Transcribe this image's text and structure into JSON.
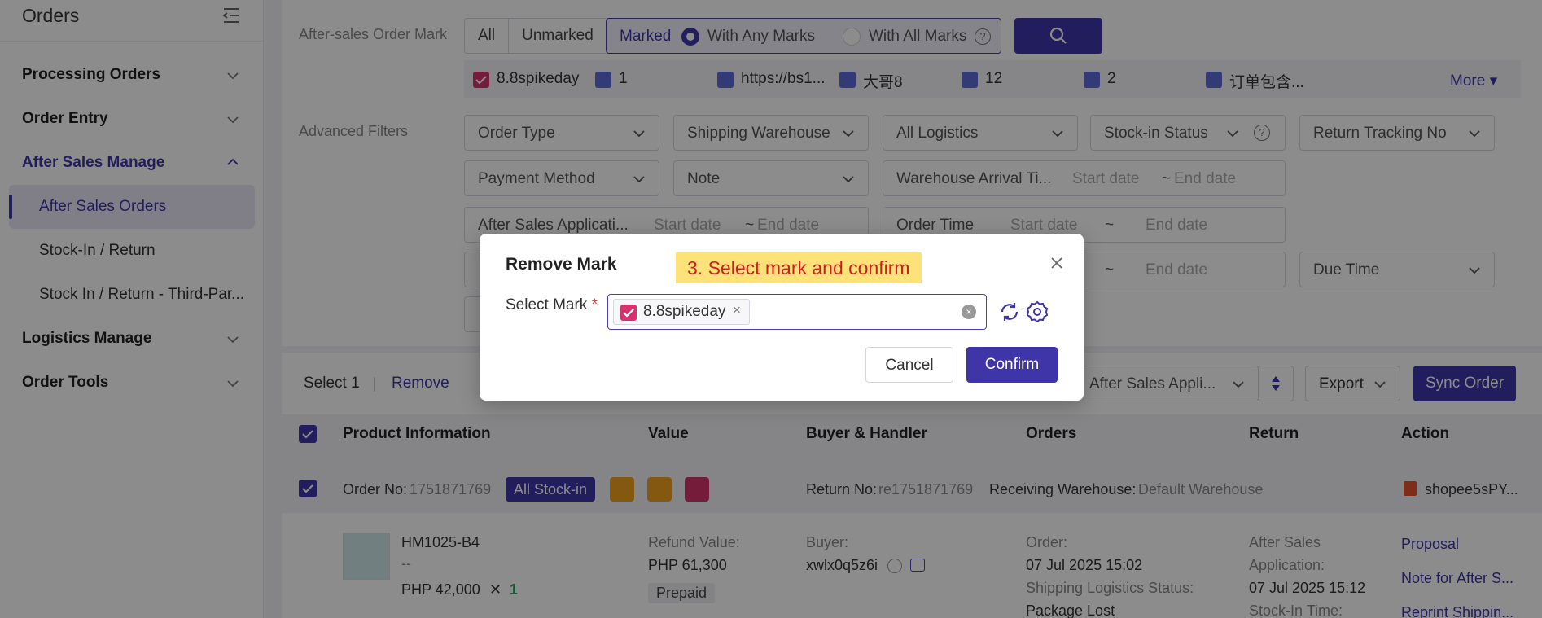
{
  "sidebar": {
    "title": "Orders",
    "groups": [
      {
        "label": "Processing Orders"
      },
      {
        "label": "Order Entry"
      },
      {
        "label": "After Sales Manage"
      },
      {
        "label": "Logistics Manage"
      },
      {
        "label": "Order Tools"
      }
    ],
    "items": [
      {
        "label": "After Sales Orders"
      },
      {
        "label": "Stock-In / Return"
      },
      {
        "label": "Stock In / Return - Third-Par..."
      }
    ]
  },
  "filters": {
    "mark_label": "After-sales Order Mark",
    "seg_all": "All",
    "seg_unmarked": "Unmarked",
    "seg_marked": "Marked",
    "radio_any": "With Any Marks",
    "radio_all": "With All Marks",
    "help": "?",
    "marks": [
      {
        "label": "8.8spikeday",
        "color": "#d6336c"
      },
      {
        "label": "1",
        "color": "#5b6cd6"
      },
      {
        "label": "https://bs1...",
        "color": "#5b6cd6"
      },
      {
        "label": "大哥8",
        "color": "#5b6cd6"
      },
      {
        "label": "12",
        "color": "#5b6cd6"
      },
      {
        "label": "2",
        "color": "#5b6cd6"
      },
      {
        "label": "订单包含...",
        "color": "#5b6cd6"
      }
    ],
    "more": "More",
    "advanced_label": "Advanced Filters",
    "order_type": "Order Type",
    "shipping_warehouse": "Shipping Warehouse",
    "all_logistics": "All Logistics",
    "stockin_status": "Stock-in Status",
    "return_tracking": "Return Tracking No",
    "payment_method": "Payment Method",
    "note": "Note",
    "warehouse_arrival": "Warehouse Arrival Ti...",
    "start_date": "Start date",
    "end_date": "End date",
    "tilde": "~",
    "after_sales_app": "After Sales Applicati...",
    "order_time": "Order Time",
    "due_time": "Due Time"
  },
  "toolbar": {
    "select_count": "Select 1",
    "remove": "Remove",
    "sort_field": "After Sales Appli...",
    "export": "Export",
    "sync": "Sync Order"
  },
  "table": {
    "headers": [
      "Product Information",
      "Value",
      "Buyer & Handler",
      "Orders",
      "Return",
      "Action"
    ],
    "order_no_label": "Order No:",
    "order_no": "1751871769",
    "stock_badge": "All Stock-in",
    "return_no_label": "Return No:",
    "return_no": "re1751871769",
    "receiving_label": "Receiving Warehouse:",
    "receiving_value": "Default Warehouse",
    "shop": "shopee5sPY...",
    "sku": "HM1025-B4",
    "dash": "--",
    "price": "PHP 42,000",
    "times": "✕",
    "qty": "1",
    "refund_label": "Refund Value:",
    "refund_value": "PHP 61,300",
    "prepaid": "Prepaid",
    "buyer_label": "Buyer:",
    "buyer": "xwlx0q5z6i",
    "order_label": "Order:",
    "order_time": "07 Jul 2025 15:02",
    "ship_status_label": "Shipping Logistics Status:",
    "ship_status": "Package Lost",
    "asa_label_1": "After Sales",
    "asa_label_2": "Application:",
    "asa_time": "07 Jul 2025 15:12",
    "stockin_time_label": "Stock-In Time:",
    "actions": [
      "Proposal",
      "Note for After S...",
      "Reprint Shippin..."
    ]
  },
  "modal": {
    "title": "Remove Mark",
    "annotation": "3. Select mark and confirm",
    "field_label": "Select Mark",
    "required": "*",
    "tag": {
      "label": "8.8spikeday",
      "color": "#d6336c"
    },
    "tag_remove": "×",
    "clear": "×",
    "cancel": "Cancel",
    "confirm": "Confirm"
  },
  "colors": {
    "primary": "#3f35a8",
    "mark_red": "#d6336c",
    "mark_blue": "#5b6cd6",
    "badge_orange": "#f0a020"
  }
}
